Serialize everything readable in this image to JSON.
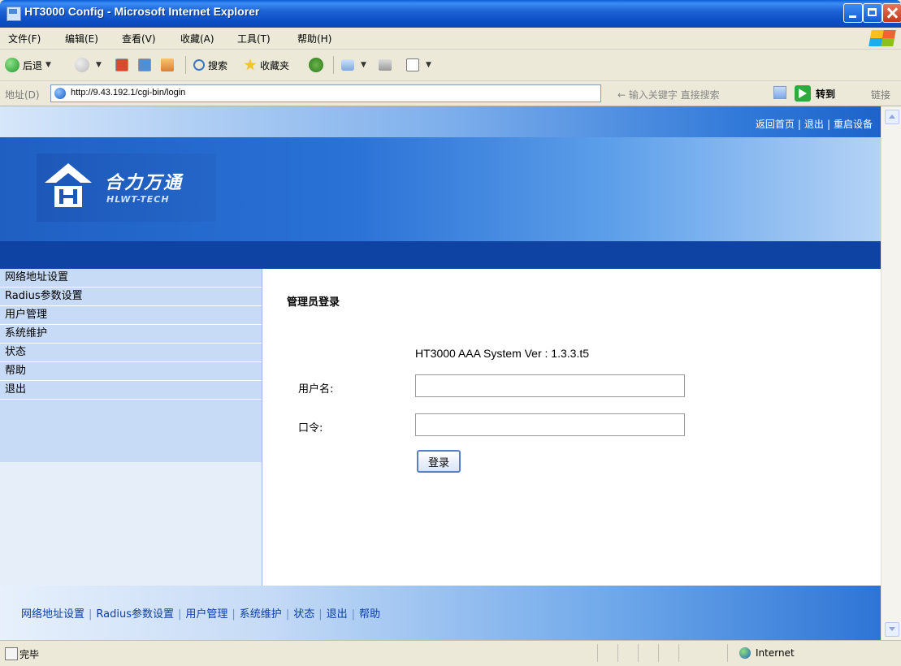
{
  "window": {
    "title": "HT3000 Config - Microsoft Internet Explorer"
  },
  "menu": [
    "文件(F)",
    "编辑(E)",
    "查看(V)",
    "收藏(A)",
    "工具(T)",
    "帮助(H)"
  ],
  "toolbar": {
    "back_label": "后退",
    "search_label": "搜索",
    "favorites_label": "收藏夹"
  },
  "address": {
    "label": "地址(D)",
    "url": "http://9.43.192.1/cgi-bin/login",
    "search_placeholder": "← 输入关键字 直接搜索",
    "go_label": "转到",
    "links_label": "链接"
  },
  "top_links": [
    "返回首页",
    "退出",
    "重启设备"
  ],
  "logo": {
    "cn": "合力万通",
    "en": "HLWT-TECH"
  },
  "sidebar": [
    "网络地址设置",
    "Radius参数设置",
    "用户管理",
    "系统维护",
    "状态",
    "帮助",
    "退出"
  ],
  "login": {
    "title": "管理员登录",
    "version": "HT3000 AAA System Ver : 1.3.3.t5",
    "username_label": "用户名:",
    "username_value": "",
    "password_label": "口令:",
    "password_value": "",
    "button_label": "登录"
  },
  "footer_links": [
    "网络地址设置",
    "Radius参数设置",
    "用户管理",
    "系统维护",
    "状态",
    "退出",
    "帮助"
  ],
  "status": {
    "text": "完毕",
    "zone": "Internet"
  }
}
